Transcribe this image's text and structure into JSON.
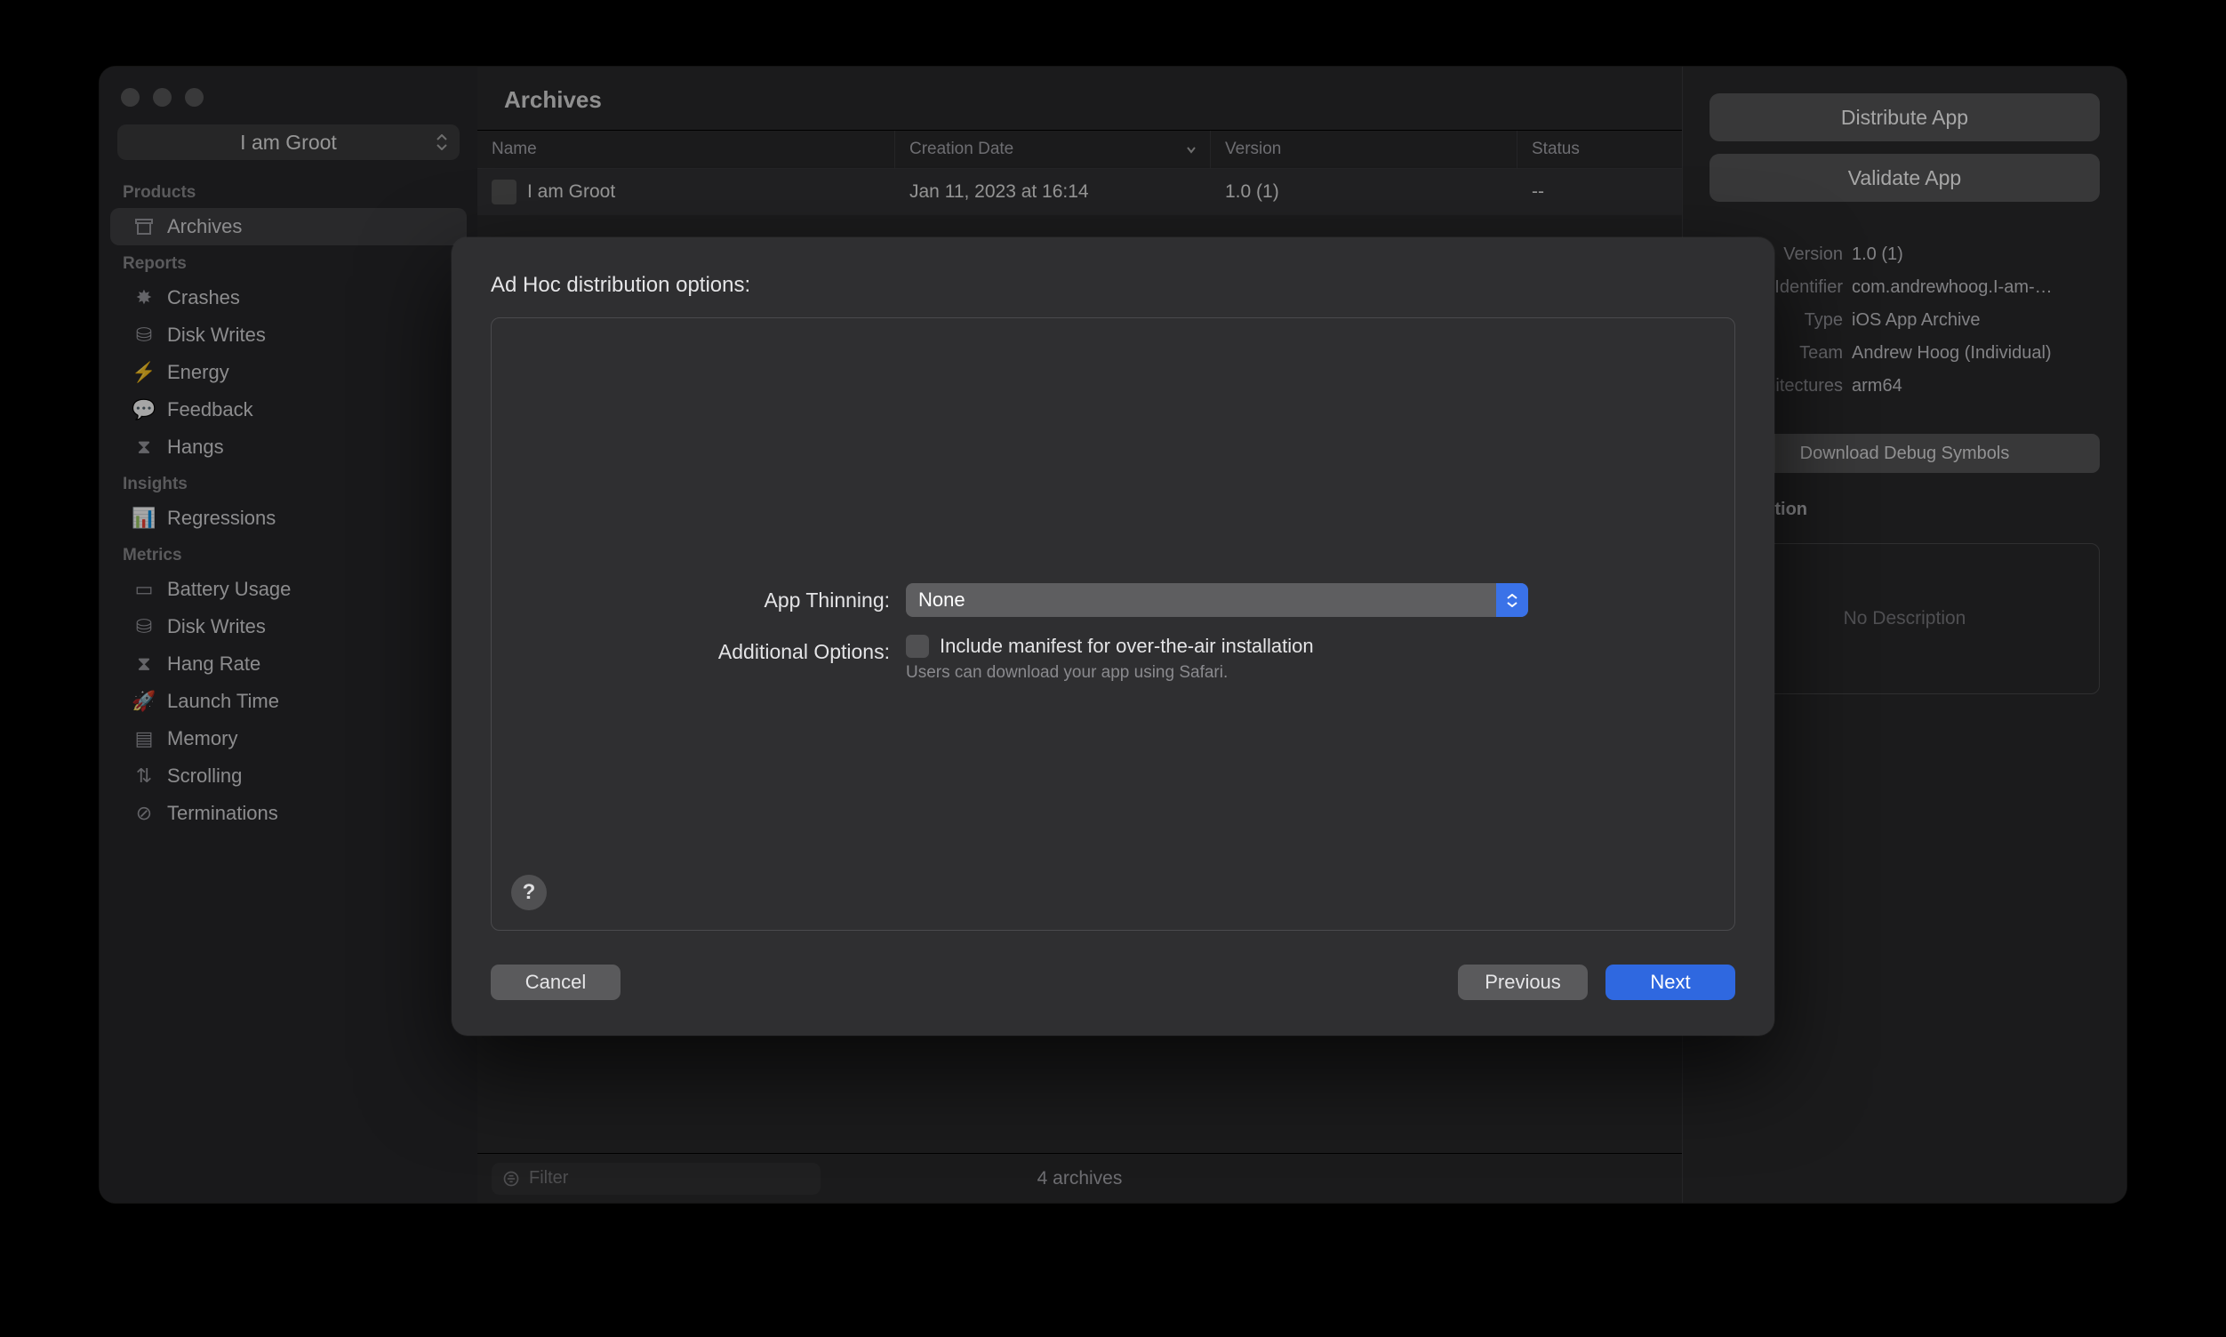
{
  "app_selector": "I am Groot",
  "sidebar": {
    "products_header": "Products",
    "products": [
      {
        "label": "Archives"
      }
    ],
    "reports_header": "Reports",
    "reports": [
      {
        "label": "Crashes"
      },
      {
        "label": "Disk Writes"
      },
      {
        "label": "Energy"
      },
      {
        "label": "Feedback"
      },
      {
        "label": "Hangs"
      }
    ],
    "insights_header": "Insights",
    "insights": [
      {
        "label": "Regressions"
      }
    ],
    "metrics_header": "Metrics",
    "metrics": [
      {
        "label": "Battery Usage"
      },
      {
        "label": "Disk Writes"
      },
      {
        "label": "Hang Rate"
      },
      {
        "label": "Launch Time"
      },
      {
        "label": "Memory"
      },
      {
        "label": "Scrolling"
      },
      {
        "label": "Terminations"
      }
    ]
  },
  "main": {
    "title": "Archives",
    "columns": {
      "name": "Name",
      "date": "Creation Date",
      "version": "Version",
      "status": "Status"
    },
    "rows": [
      {
        "name": "I am Groot",
        "date": "Jan 11, 2023 at 16:14",
        "version": "1.0 (1)",
        "status": "--"
      }
    ],
    "filter_placeholder": "Filter",
    "footer_status": "4 archives"
  },
  "rightpane": {
    "distribute": "Distribute App",
    "validate": "Validate App",
    "info": {
      "version_label": "Version",
      "version": "1.0 (1)",
      "identifier_label": "Identifier",
      "identifier": "com.andrewhoog.I-am-…",
      "type_label": "Type",
      "type": "iOS App Archive",
      "team_label": "Team",
      "team": "Andrew Hoog (Individual)",
      "arch_label": "Architectures",
      "arch": "arm64"
    },
    "download_symbols": "Download Debug Symbols",
    "description_label": "Description",
    "description_placeholder": "No Description"
  },
  "dialog": {
    "title": "Ad Hoc distribution options:",
    "app_thinning_label": "App Thinning:",
    "app_thinning_value": "None",
    "additional_options_label": "Additional Options:",
    "manifest_label": "Include manifest for over-the-air installation",
    "manifest_hint": "Users can download your app using Safari.",
    "cancel": "Cancel",
    "previous": "Previous",
    "next": "Next",
    "help": "?"
  }
}
